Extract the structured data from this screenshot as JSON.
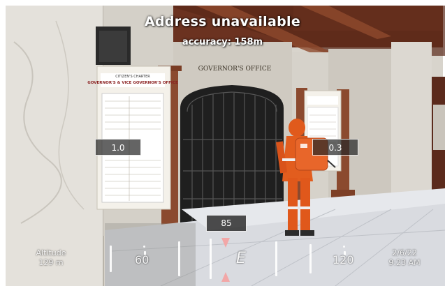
{
  "hud": {
    "address": "Address unavailable",
    "accuracy": "accuracy: 158m",
    "left_angle": "1.0",
    "right_angle": "0.3",
    "heading": "85",
    "altitude_label": "Altitude",
    "altitude_value": "129 m",
    "date": "2/6/22",
    "time": "9:23 AM"
  },
  "compass": {
    "left_value": "60",
    "direction": "E",
    "right_value": "120"
  },
  "scene": {
    "sign_header_line1": "CITIZEN'S CHARTER",
    "sign_header_line2": "GOVERNOR'S & VICE GOVERNOR'S OFFICE",
    "door_sign": "GOVERNOR'S OFFICE",
    "colors": {
      "marble": "#d9d6cf",
      "wood_pillar": "#8b4a2f",
      "ceiling": "#6a2f1e",
      "orange_suit": "#e05a1c",
      "pointer": "#f2a7a7"
    }
  }
}
